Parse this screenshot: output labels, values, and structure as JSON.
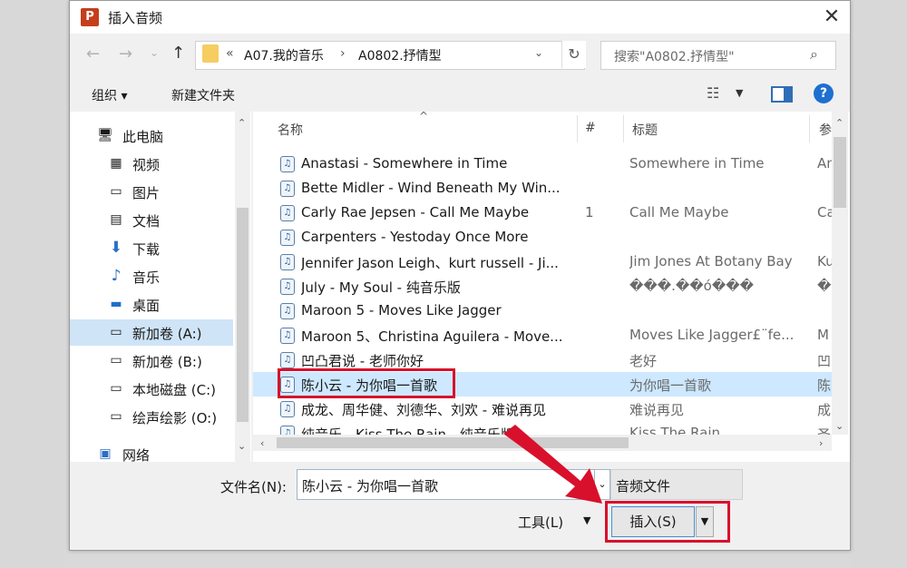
{
  "dialog": {
    "title": "插入音频",
    "app_icon_letter": "P"
  },
  "address": {
    "prefix": "«",
    "crumbs": [
      "A07.我的音乐",
      "A0802.抒情型"
    ],
    "separator": "›"
  },
  "search": {
    "placeholder": "搜索\"A0802.抒情型\""
  },
  "toolbar": {
    "organize": "组织 ▾",
    "new_folder": "新建文件夹"
  },
  "nav": [
    {
      "label": "此电脑",
      "icon": "computer-icon"
    },
    {
      "label": "视频",
      "icon": "video-icon"
    },
    {
      "label": "图片",
      "icon": "picture-icon"
    },
    {
      "label": "文档",
      "icon": "document-icon"
    },
    {
      "label": "下载",
      "icon": "download-icon"
    },
    {
      "label": "音乐",
      "icon": "music-icon"
    },
    {
      "label": "桌面",
      "icon": "desktop-icon"
    },
    {
      "label": "新加卷 (A:)",
      "icon": "drive-icon",
      "selected": true
    },
    {
      "label": "新加卷 (B:)",
      "icon": "drive-icon"
    },
    {
      "label": "本地磁盘 (C:)",
      "icon": "drive-icon"
    },
    {
      "label": "绘声绘影 (O:)",
      "icon": "drive-icon"
    },
    {
      "label": "网络",
      "icon": "network-icon"
    }
  ],
  "columns": {
    "name": "名称",
    "number": "#",
    "title": "标题",
    "extra": "参"
  },
  "files": [
    {
      "name": "Anastasi - Somewhere in Time",
      "num": "",
      "title": "Somewhere in Time",
      "extra": "An"
    },
    {
      "name": "Bette Midler - Wind Beneath My Win...",
      "num": "",
      "title": "",
      "extra": ""
    },
    {
      "name": "Carly Rae Jepsen - Call Me Maybe",
      "num": "1",
      "title": "Call Me Maybe",
      "extra": "Ca"
    },
    {
      "name": "Carpenters - Yestoday Once More",
      "num": "",
      "title": "",
      "extra": ""
    },
    {
      "name": "Jennifer Jason Leigh、kurt russell - Ji...",
      "num": "",
      "title": "Jim Jones At Botany Bay",
      "extra": "Ku"
    },
    {
      "name": "July - My Soul - 纯音乐版",
      "num": "",
      "title": "���.��ó���",
      "extra": "��"
    },
    {
      "name": "Maroon 5 - Moves Like Jagger",
      "num": "",
      "title": "",
      "extra": ""
    },
    {
      "name": "Maroon 5、Christina Aguilera - Move...",
      "num": "",
      "title": "Moves Like Jagger£¨fe...",
      "extra": "M"
    },
    {
      "name": "凹凸君说 - 老师你好",
      "num": "",
      "title": "老好",
      "extra": "凹"
    },
    {
      "name": "陈小云 - 为你唱一首歌",
      "num": "",
      "title": "为你唱一首歌",
      "extra": "陈",
      "selected": true
    },
    {
      "name": "成龙、周华健、刘德华、刘欢 - 难说再见",
      "num": "",
      "title": "难说再见",
      "extra": "成"
    },
    {
      "name": "纯音乐 - Kiss The Rain - 纯音乐版",
      "num": "",
      "title": "Kiss The Rain",
      "extra": "圣"
    }
  ],
  "bottom": {
    "filename_label": "文件名(N):",
    "filename_value": "陈小云 - 为你唱一首歌",
    "filetype": "音频文件",
    "tools": "工具(L)",
    "insert": "插入(S)"
  },
  "colors": {
    "highlight": "#d9102c",
    "selection": "#cde8ff",
    "accent": "#1e6fd0"
  }
}
